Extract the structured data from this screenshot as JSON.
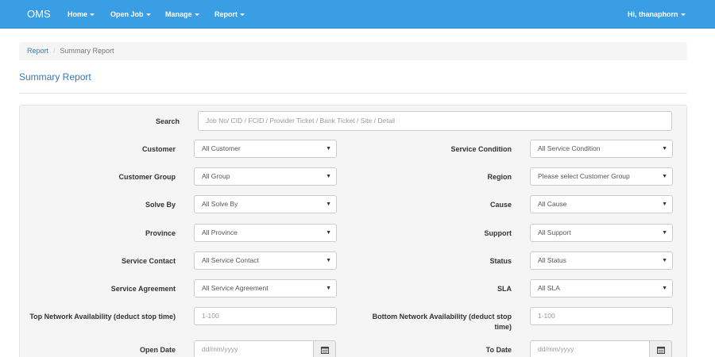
{
  "navbar": {
    "brand": "OMS",
    "menus": [
      "Home",
      "Open Job",
      "Manage",
      "Report"
    ],
    "user": "Hi, thanaphorn"
  },
  "breadcrumb": {
    "link": "Report",
    "separator": "/",
    "current": "Summary Report"
  },
  "page_title": "Summary Report",
  "form": {
    "search": {
      "label": "Search",
      "placeholder": "Job No/ CID / FCID / Provider Ticket / Bank Ticket / Site / Detail"
    },
    "customer": {
      "label": "Customer",
      "value": "All Customer"
    },
    "customer_group": {
      "label": "Customer Group",
      "value": "All Group"
    },
    "solve_by": {
      "label": "Solve By",
      "value": "All Solve By"
    },
    "province": {
      "label": "Province",
      "value": "All Province"
    },
    "service_contact": {
      "label": "Service Contact",
      "value": "All Service Contact"
    },
    "service_agreement": {
      "label": "Service Agreement",
      "value": "All Service Agreement"
    },
    "top_availability": {
      "label": "Top Network Availability (deduct stop time)",
      "placeholder": "1-100"
    },
    "open_date": {
      "label": "Open Date",
      "placeholder": "dd/mm/yyyy"
    },
    "service_condition": {
      "label": "Service Condition",
      "value": "All Service Condition"
    },
    "region": {
      "label": "Region",
      "value": "Please select Customer Group"
    },
    "cause": {
      "label": "Cause",
      "value": "All Cause"
    },
    "support": {
      "label": "Support",
      "value": "All Support"
    },
    "status": {
      "label": "Status",
      "value": "All Status"
    },
    "sla": {
      "label": "SLA",
      "value": "All SLA"
    },
    "bottom_availability": {
      "label_line1": "Bottom Network Availability (deduct stop",
      "label_line2": "time)",
      "placeholder": "1-100"
    },
    "to_date": {
      "label": "To Date",
      "placeholder": "dd/mm/yyyy"
    }
  },
  "icons": {
    "dropdown": "triangle-down-icon",
    "calendar": "calendar-icon"
  },
  "colors": {
    "navbar": "#3a9ee4",
    "link": "#337ab7"
  }
}
